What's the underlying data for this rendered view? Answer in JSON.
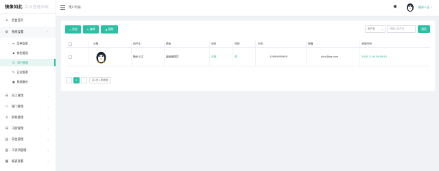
{
  "logo": {
    "brand": "镜像如此",
    "subtitle": "后台管理系统"
  },
  "topbar": {
    "breadcrumb": "用户列表",
    "username": "随米人达"
  },
  "sidebar": {
    "home": {
      "label": "后台首页",
      "icon": "home-icon"
    },
    "system": {
      "label": "系统设置",
      "icon": "gear-icon",
      "children": [
        {
          "label": "菜单管理",
          "icon": "menu-icon"
        },
        {
          "label": "角色管理",
          "icon": "role-icon"
        },
        {
          "label": "用户管理",
          "icon": "user-icon",
          "active": true
        },
        {
          "label": "日志管理",
          "icon": "log-icon"
        },
        {
          "label": "数据备份",
          "icon": "backup-icon"
        }
      ]
    },
    "items": [
      {
        "label": "员工管理",
        "icon": "staff-icon"
      },
      {
        "label": "部门管理",
        "icon": "department-icon"
      },
      {
        "label": "职称管理",
        "icon": "title-icon"
      },
      {
        "label": "工龄管理",
        "icon": "seniority-icon"
      },
      {
        "label": "岗位管理",
        "icon": "position-icon"
      },
      {
        "label": "工资项管理",
        "icon": "salary-icon"
      },
      {
        "label": "报表查看",
        "icon": "report-icon"
      }
    ]
  },
  "toolbar": {
    "add": "添加",
    "edit": "编辑",
    "delete": "删除"
  },
  "search": {
    "field": "用户名",
    "placeholder": "请输入用户名",
    "button": "搜索"
  },
  "table": {
    "headers": [
      "头像",
      "用户名",
      "角色",
      "状态",
      "性别",
      "手机",
      "邮箱",
      "添加时间"
    ],
    "rows": [
      {
        "username": "随米人达",
        "role": "超级管理员",
        "status": "正常",
        "gender": "男",
        "phone": "15959595959",
        "email": "yilrc@qq.com",
        "created": "2020-3-16 19:18:53"
      }
    ]
  },
  "pagination": {
    "prev": "‹",
    "page": "1",
    "next": "›",
    "total": "共1页,1条数据"
  },
  "colors": {
    "accent": "#2bbfa3",
    "text_accent": "#1aad8d"
  }
}
